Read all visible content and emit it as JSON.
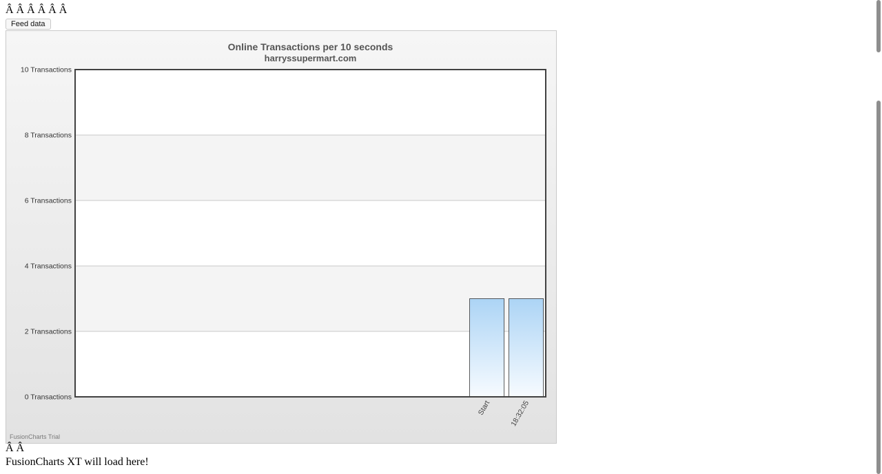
{
  "page": {
    "top_glyphs": "Â Â  Â Â  Â Â",
    "feed_button_label": "Feed data",
    "bottom_glyphs": "Â Â",
    "loading_message": "FusionCharts XT will load here!",
    "trial_label": "FusionCharts Trial"
  },
  "chart_data": {
    "type": "bar",
    "title": "Online Transactions per 10 seconds",
    "subtitle": "harryssupermart.com",
    "categories": [
      "Start",
      "18:32:05"
    ],
    "values": [
      3,
      3
    ],
    "ylim": [
      0,
      10
    ],
    "yticks": [
      0,
      2,
      4,
      6,
      8,
      10
    ],
    "ytick_suffix": " Transactions",
    "slots": 12,
    "grid": true,
    "colors": {
      "bar_top": "#acd4f5",
      "bar_bottom": "#f7fbff",
      "bar_border": "#333333",
      "band": "#f4f4f4",
      "grid": "#c8c8c8",
      "axis": "#404040"
    }
  }
}
